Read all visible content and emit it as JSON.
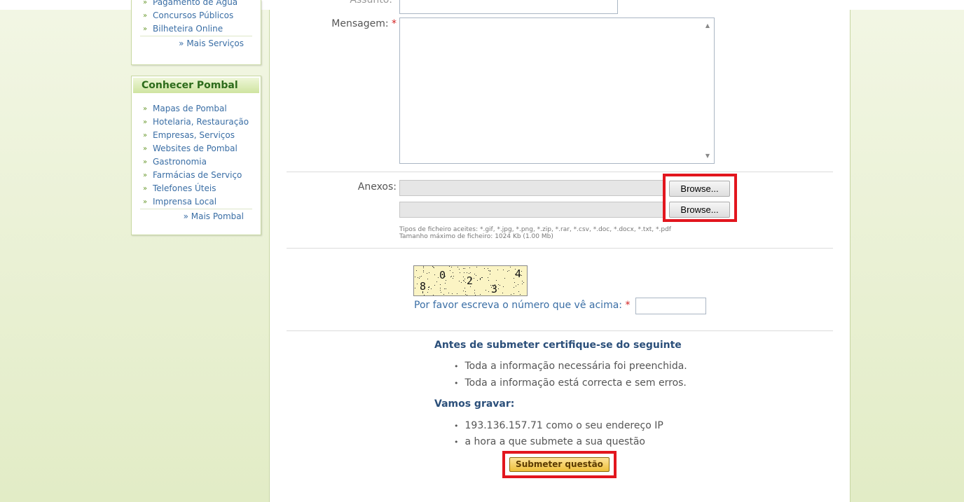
{
  "sidebar": {
    "services_box": {
      "items": [
        {
          "label": "Pagamento de Água"
        },
        {
          "label": "Concursos Públicos"
        },
        {
          "label": "Bilheteira Online"
        }
      ],
      "more_label": "» Mais Serviços"
    },
    "pombal_box": {
      "title": "Conhecer Pombal",
      "items": [
        {
          "label": "Mapas de Pombal"
        },
        {
          "label": "Hotelaria, Restauração"
        },
        {
          "label": "Empresas, Serviços"
        },
        {
          "label": "Websites de Pombal"
        },
        {
          "label": "Gastronomia"
        },
        {
          "label": "Farmácias de Serviço"
        },
        {
          "label": "Telefones Úteis"
        },
        {
          "label": "Imprensa Local"
        }
      ],
      "more_label": "» Mais Pombal"
    },
    "bullet_glyph": "»"
  },
  "form": {
    "subject_label": "Assunto:",
    "message_label": "Mensagem:",
    "required_mark": "*",
    "attachments_label": "Anexos:",
    "browse_label_1": "Browse...",
    "browse_label_2": "Browse...",
    "file_types_hint": "Tipos de ficheiro aceites: *.gif, *.jpg, *.png, *.zip, *.rar, *.csv, *.doc, *.docx, *.txt, *.pdf",
    "file_size_hint": "Tamanho máximo de ficheiro: 1024 Kb (1.00 Mb)",
    "captcha_digits": [
      "8",
      "0",
      "2",
      "3",
      "4"
    ],
    "captcha_prompt": "Por favor escreva o número que vê acima:"
  },
  "notice": {
    "title": "Antes de submeter certifique-se do seguinte",
    "items": [
      "Toda a informação necessária foi preenchida.",
      "Toda a informação está correcta e sem erros."
    ],
    "record_title": "Vamos gravar:",
    "record_items": [
      "193.136.157.71 como o seu endereço IP",
      "a hora a que submete a sua questão"
    ],
    "bullet_glyph": "•"
  },
  "submit_label": "Submeter questão",
  "colors": {
    "highlight_box": "#e2161e",
    "link": "#3a6ea5",
    "header_green": "#2d6b1b",
    "required": "#d21f1f",
    "submit_gold": "#eebf3a"
  }
}
